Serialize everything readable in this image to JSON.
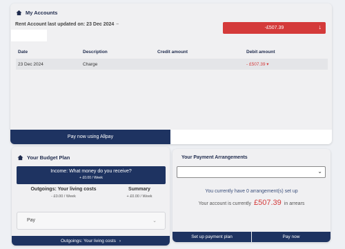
{
  "accounts": {
    "title": "My Accounts",
    "updated_text": "Rent Account last updated on: 23 Dec 2024",
    "updated_dash": "–",
    "balance": "-£507.39",
    "balance_arrow": "↓",
    "table": {
      "headers": [
        "Date",
        "Description",
        "Credit amount",
        "Debit amount"
      ],
      "rows": [
        {
          "date": "23 Dec 2024",
          "description": "Charge",
          "credit": "",
          "debit": "- £507.39 ▾"
        }
      ]
    },
    "allpay_label": "Pay now using Allpay"
  },
  "budget": {
    "title": "Your Budget Plan",
    "income_label": "Income: What money do you receive?",
    "income_sub": "+ £0.00 / Week",
    "outgoings_label": "Outgoings: Your living costs",
    "outgoings_value": "- £0.00 / Week",
    "summary_label": "Summary",
    "summary_value": "+ £0.00 / Week",
    "pay_label": "Pay",
    "pay_chevron": "⌄",
    "outgoings_button": "Outgoings: Your living costs",
    "outgoings_button_chevron": "›"
  },
  "arrangements": {
    "title": "Your Payment Arrangements",
    "select_value": "",
    "select_chevron": "⌄",
    "count_text": "You currently have 0 arrangement(s) set up",
    "status_prefix": "Your account is currently",
    "status_amount": "£507.39",
    "status_suffix": "in arrears",
    "setup_button": "Set up payment plan",
    "paynow_button": "Pay now"
  },
  "colors": {
    "navy": "#1e3361",
    "alert_red": "#d43a3a"
  },
  "icons": {
    "accounts_icon": "house-icon",
    "budget_icon": "house-icon"
  }
}
